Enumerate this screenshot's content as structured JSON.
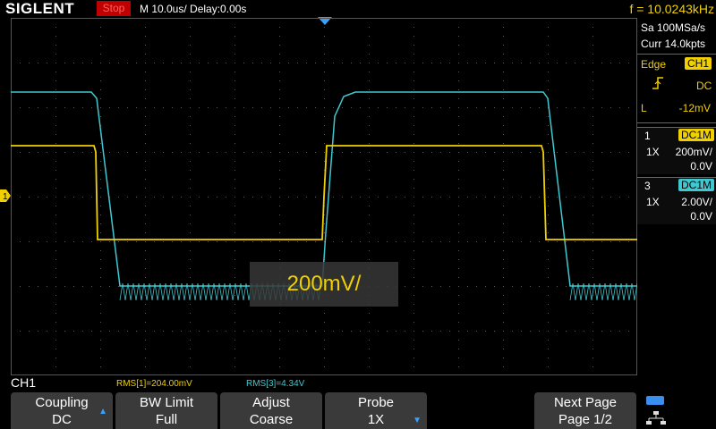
{
  "header": {
    "logo": "SIGLENT",
    "status": "Stop",
    "timebase": "M 10.0us/",
    "delay": "Delay:0.00s",
    "frequency": "f = 10.0243kHz"
  },
  "acquisition": {
    "sample_rate": "Sa 100MSa/s",
    "memory": "Curr 14.0kpts"
  },
  "trigger": {
    "mode": "Edge",
    "source": "CH1",
    "coupling": "DC",
    "level_label": "L",
    "level": "-12mV"
  },
  "channels": [
    {
      "num": "1",
      "coupling": "DC1M",
      "probe": "1X",
      "scale": "200mV/",
      "offset": "0.0V",
      "color": "#f0d000"
    },
    {
      "num": "3",
      "coupling": "DC1M",
      "probe": "1X",
      "scale": "2.00V/",
      "offset": "0.0V",
      "color": "#40c8d0"
    }
  ],
  "popup": {
    "text": "200mV/"
  },
  "measure": {
    "active_channel": "CH1",
    "rms1": "RMS[1]=204.00mV",
    "rms3": "RMS[3]=4.34V"
  },
  "softkeys": [
    {
      "line1": "Coupling",
      "line2": "DC"
    },
    {
      "line1": "BW Limit",
      "line2": "Full"
    },
    {
      "line1": "Adjust",
      "line2": "Coarse"
    },
    {
      "line1": "Probe",
      "line2": "1X"
    },
    {
      "line1": "Next Page",
      "line2": "Page 1/2"
    }
  ],
  "marker": {
    "ch1": "1"
  },
  "colors": {
    "ch1": "#f0d000",
    "ch3": "#40c8d0",
    "stop": "#c00000",
    "softkey_bg": "#3a3a3a",
    "accent": "#3a8ef0"
  }
}
